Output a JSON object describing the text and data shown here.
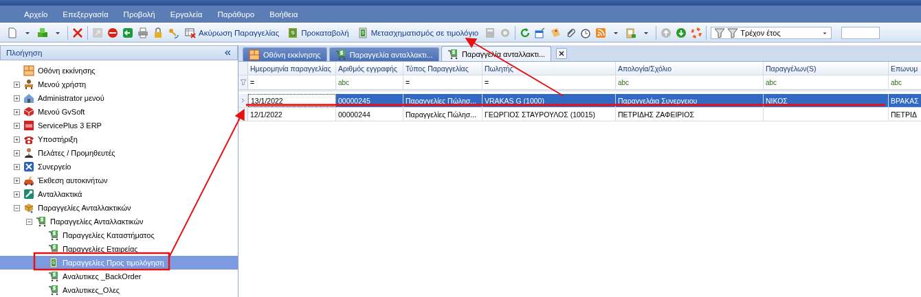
{
  "menu": [
    "Αρχείο",
    "Επεξεργασία",
    "Προβολή",
    "Εργαλεία",
    "Παράθυρο",
    "Βοήθεια"
  ],
  "toolbar": {
    "cancel_order": "Ακύρωση Παραγγελίας",
    "advance_payment": "Προκαταβολή",
    "convert_to_invoice": "Μετασχηματισμός σε τιμολόγιο",
    "year_filter": "Τρέχον έτος"
  },
  "navigation": {
    "title": "Πλοήγηση",
    "items": [
      {
        "label": "Οθόνη εκκίνησης",
        "selected": false
      },
      {
        "label": "Μενού χρήστη",
        "selected": false,
        "expanded": false
      },
      {
        "label": "Administrator μενού",
        "selected": false,
        "expanded": false
      },
      {
        "label": "Μενού GvSoft",
        "selected": false,
        "expanded": false
      },
      {
        "label": "ServicePlus 3 ERP",
        "selected": false,
        "expanded": false
      },
      {
        "label": "Υποστήριξη",
        "selected": false,
        "expanded": false
      },
      {
        "label": "Πελάτες / Προμηθευτές",
        "selected": false,
        "expanded": false
      },
      {
        "label": "Συνεργείο",
        "selected": false,
        "expanded": false
      },
      {
        "label": "Έκθεση αυτοκινήτων",
        "selected": false,
        "expanded": false
      },
      {
        "label": "Ανταλλακτικά",
        "selected": false,
        "expanded": false
      },
      {
        "label": "Παραγγελίες Ανταλλακτικών",
        "selected": false,
        "expanded": true,
        "children": [
          {
            "label": "Παραγγελίες Ανταλλακτικών",
            "selected": false,
            "expanded": true,
            "children": [
              {
                "label": "Παραγγελίες  Καταστήματος",
                "selected": false
              },
              {
                "label": "Παραγγελίες  Εταιρείας",
                "selected": false
              },
              {
                "label": "Παραγγελίες Προς τιμολόγηση",
                "selected": true
              },
              {
                "label": "Αναλυτικες _BackOrder",
                "selected": false
              },
              {
                "label": "Αναλυτικες_Ολες",
                "selected": false
              }
            ]
          }
        ]
      }
    ]
  },
  "tabs": [
    {
      "label": "Οθόνη εκκίνησης",
      "selected": false
    },
    {
      "label": "Παραγγελία ανταλλακτι...",
      "selected": false
    },
    {
      "label": "Παραγγελία ανταλλακτι...",
      "selected": true
    }
  ],
  "grid": {
    "columns": [
      {
        "label": "Ημερομηνία παραγγελίας",
        "filter": "="
      },
      {
        "label": "Αριθμός εγγραφής",
        "filter": "abc"
      },
      {
        "label": "Τύπος Παραγγελίας",
        "filter": "="
      },
      {
        "label": "Πωλητής",
        "filter": "="
      },
      {
        "label": "Απολογία/Σχόλιο",
        "filter": "abc"
      },
      {
        "label": "Παραγγέλων(S)",
        "filter": "abc"
      },
      {
        "label": "Επωνυμ",
        "filter": "abc"
      }
    ],
    "rows": [
      {
        "selected": true,
        "cells": [
          "13/1/2022",
          "00000245",
          "Παραγγελίες Πώλησ...",
          "VRAKAS G (1000)",
          "Παραγγελάια Συνεργειου",
          "ΝΙΚΟΣ",
          "ΒΡΑΚΑΣ"
        ]
      },
      {
        "selected": false,
        "cells": [
          "12/1/2022",
          "00000244",
          "Παραγγελίες Πώλησ...",
          "ΓΕΩΡΓΙΟΣ ΣΤΑΥΡΟΥΛΟΣ   (10015)",
          "ΠΕΤΡΙΔΗΣ ΖΑΦΕΙΡΙΟΣ",
          "",
          "ΠΕΤΡΙΔ"
        ]
      }
    ]
  }
}
